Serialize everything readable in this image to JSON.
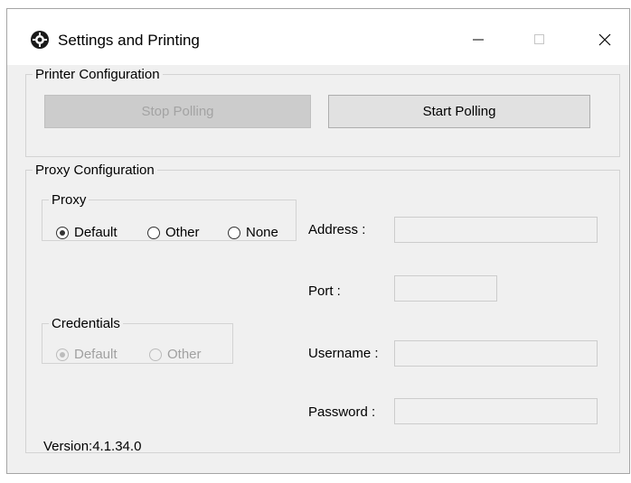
{
  "window": {
    "title": "Settings and Printing",
    "icon": "gear-icon",
    "controls": [
      "minimize-icon",
      "maximize-icon",
      "close-icon"
    ]
  },
  "printer_config": {
    "legend": "Printer Configuration",
    "stop_label": "Stop Polling",
    "stop_enabled": false,
    "start_label": "Start Polling"
  },
  "proxy_config": {
    "legend": "Proxy Configuration",
    "proxy": {
      "legend": "Proxy",
      "options": [
        "Default",
        "Other",
        "None"
      ],
      "selected": "Default"
    },
    "credentials": {
      "legend": "Credentials",
      "options": [
        "Default",
        "Other"
      ],
      "selected": "Default",
      "enabled": false
    },
    "fields": {
      "address_label": "Address :",
      "address_value": "",
      "port_label": "Port :",
      "port_value": "",
      "username_label": "Username :",
      "username_value": "",
      "password_label": "Password :",
      "password_value": ""
    }
  },
  "version": "Version:4.1.34.0"
}
